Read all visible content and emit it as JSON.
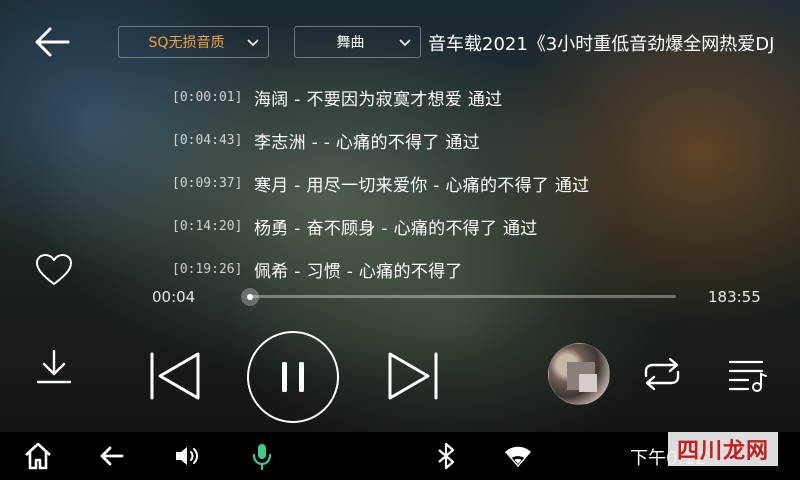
{
  "header": {
    "quality_label": "SQ无损音质",
    "genre_label": "舞曲",
    "song_title": "音车载2021《3小时重低音劲爆全网热爱DJ"
  },
  "lyrics": [
    {
      "time": "[0:00:01]",
      "text": "海阔 - 不要因为寂寞才想爱 通过"
    },
    {
      "time": "[0:04:43]",
      "text": "李志洲 - - 心痛的不得了 通过"
    },
    {
      "time": "[0:09:37]",
      "text": "寒月 - 用尽一切来爱你 - 心痛的不得了 通过"
    },
    {
      "time": "[0:14:20]",
      "text": "杨勇 - 奋不顾身 - 心痛的不得了 通过"
    },
    {
      "time": "[0:19:26]",
      "text": "佩希 - 习惯 - 心痛的不得了"
    }
  ],
  "playback": {
    "elapsed": "00:04",
    "duration": "183:55",
    "progress_fraction": 0.0004,
    "state": "playing"
  },
  "icons": {
    "back": "back-arrow-icon",
    "favorite": "heart-icon",
    "download": "download-icon",
    "previous": "previous-track-icon",
    "pause": "pause-icon",
    "next": "next-track-icon",
    "repeat": "repeat-icon",
    "playlist": "playlist-icon"
  },
  "system_bar": {
    "clock": "下午0:12",
    "watermark": "四川龙网"
  },
  "colors": {
    "quality_accent": "#f2a23a",
    "mic_accent": "#3fc98a"
  }
}
